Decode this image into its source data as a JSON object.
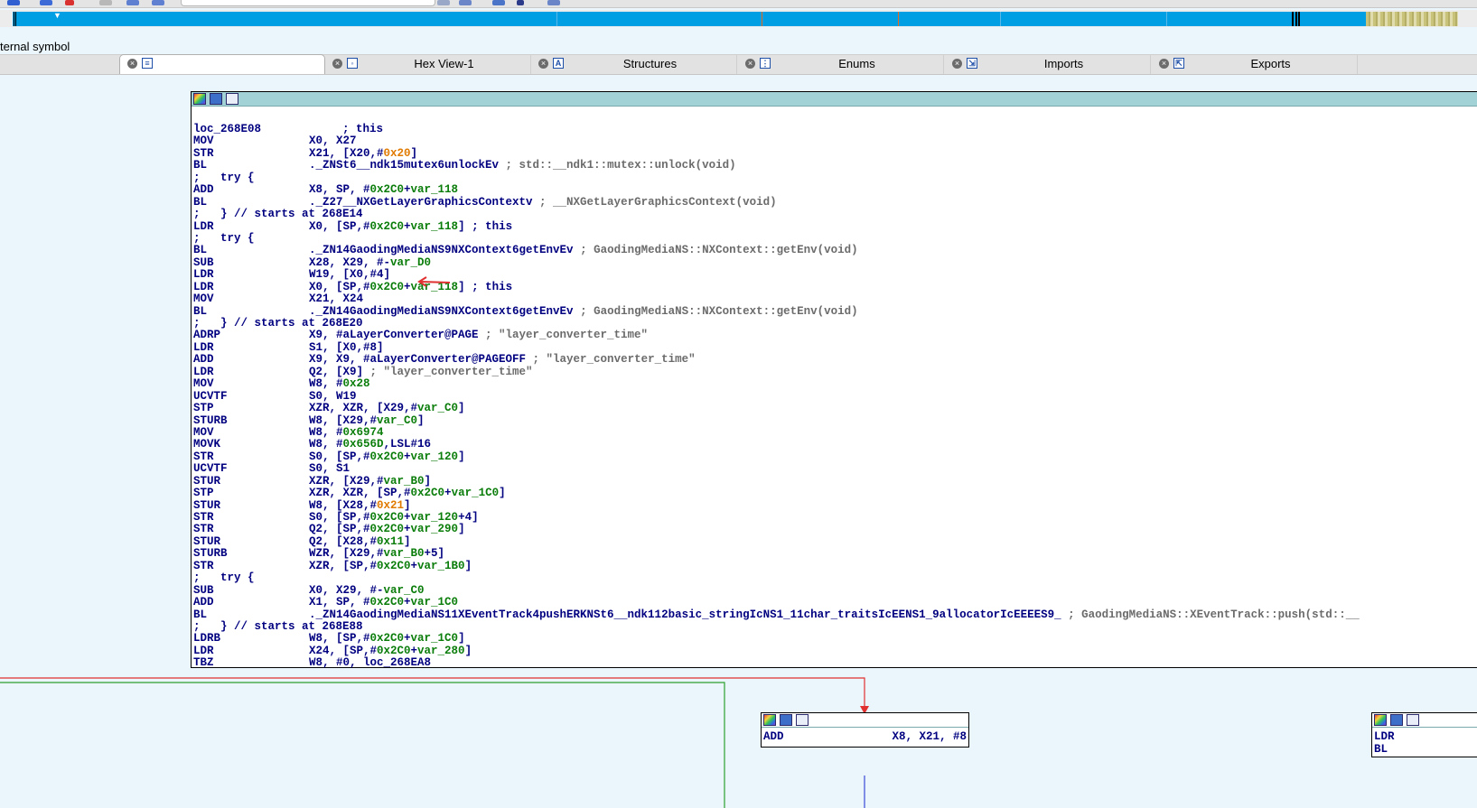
{
  "colors": {
    "nav_blue": "#009fe3",
    "nav_orange_marks": "#e66b1e",
    "node_header": "#a3d2d6",
    "edge_red": "#e03030",
    "edge_green": "#2ea02e",
    "edge_blue": "#3a4ad8",
    "instruction": "#000080",
    "number": "#0b7d0b",
    "immediate": "#e07a00",
    "comment": "#6b6b6b"
  },
  "status": {
    "text": "ternal symbol"
  },
  "tabs": [
    {
      "label": "",
      "icon": "disassembly-icon",
      "active": true
    },
    {
      "label": "Hex View-1",
      "icon": "hex-view-icon",
      "active": false
    },
    {
      "label": "Structures",
      "icon": "structures-icon",
      "active": false
    },
    {
      "label": "Enums",
      "icon": "enums-icon",
      "active": false
    },
    {
      "label": "Imports",
      "icon": "imports-icon",
      "active": false
    },
    {
      "label": "Exports",
      "icon": "exports-icon",
      "active": false
    }
  ],
  "main_node": {
    "lines": [
      [
        {
          "t": "loc_268E08",
          "c": "ops"
        },
        {
          "t": "            ; this",
          "c": "ops"
        }
      ],
      [
        {
          "t": "MOV",
          "c": "mn"
        },
        {
          "t": "X0, X27",
          "c": "ops"
        }
      ],
      [
        {
          "t": "STR",
          "c": "mn"
        },
        {
          "t": "X21, [X20,#",
          "c": "ops"
        },
        {
          "t": "0x20",
          "c": "imm"
        },
        {
          "t": "]",
          "c": "ops"
        }
      ],
      [
        {
          "t": "BL",
          "c": "mn"
        },
        {
          "t": "._ZNSt6__ndk15mutex6unlockEv",
          "c": "ops"
        },
        {
          "t": " ; std::__ndk1::mutex::unlock(void)",
          "c": "cmt"
        }
      ],
      [
        {
          "t": ";   try {",
          "c": "ops"
        }
      ],
      [
        {
          "t": "ADD",
          "c": "mn"
        },
        {
          "t": "X8, SP, #",
          "c": "ops"
        },
        {
          "t": "0x2C0",
          "c": "num"
        },
        {
          "t": "+",
          "c": "ops"
        },
        {
          "t": "var_118",
          "c": "num"
        }
      ],
      [
        {
          "t": "BL",
          "c": "mn"
        },
        {
          "t": "._Z27__NXGetLayerGraphicsContextv",
          "c": "ops"
        },
        {
          "t": " ; __NXGetLayerGraphicsContext(void)",
          "c": "cmt"
        }
      ],
      [
        {
          "t": ";   } // starts at 268E14",
          "c": "ops"
        }
      ],
      [
        {
          "t": "LDR",
          "c": "mn"
        },
        {
          "t": "X0, [SP,#",
          "c": "ops"
        },
        {
          "t": "0x2C0",
          "c": "num"
        },
        {
          "t": "+",
          "c": "ops"
        },
        {
          "t": "var_118",
          "c": "num"
        },
        {
          "t": "] ; this",
          "c": "ops"
        }
      ],
      [
        {
          "t": ";   try {",
          "c": "ops"
        }
      ],
      [
        {
          "t": "BL",
          "c": "mn"
        },
        {
          "t": "._ZN14GaodingMediaNS9NXContext6getEnvEv",
          "c": "ops"
        },
        {
          "t": " ; GaodingMediaNS::NXContext::getEnv(void)",
          "c": "cmt"
        }
      ],
      [
        {
          "t": "SUB",
          "c": "mn"
        },
        {
          "t": "X28, X29, #-",
          "c": "ops"
        },
        {
          "t": "var_D0",
          "c": "num"
        }
      ],
      [
        {
          "t": "LDR",
          "c": "mn"
        },
        {
          "t": "W19, [X0,#4]",
          "c": "ops"
        }
      ],
      [
        {
          "t": "LDR",
          "c": "mn"
        },
        {
          "t": "X0, [SP,#",
          "c": "ops"
        },
        {
          "t": "0x2C0",
          "c": "num"
        },
        {
          "t": "+",
          "c": "ops"
        },
        {
          "t": "var_118",
          "c": "num"
        },
        {
          "t": "] ; this",
          "c": "ops"
        }
      ],
      [
        {
          "t": "MOV",
          "c": "mn"
        },
        {
          "t": "X21, X24",
          "c": "ops"
        }
      ],
      [
        {
          "t": "BL",
          "c": "mn"
        },
        {
          "t": "._ZN14GaodingMediaNS9NXContext6getEnvEv",
          "c": "ops"
        },
        {
          "t": " ; GaodingMediaNS::NXContext::getEnv(void)",
          "c": "cmt"
        }
      ],
      [
        {
          "t": ";   } // starts at 268E20",
          "c": "ops"
        }
      ],
      [
        {
          "t": "ADRP",
          "c": "mn"
        },
        {
          "t": "X9, #aLayerConverter@PAGE",
          "c": "ops"
        },
        {
          "t": " ; \"layer_converter_time\"",
          "c": "cmt"
        }
      ],
      [
        {
          "t": "LDR",
          "c": "mn"
        },
        {
          "t": "S1, [X0,#8]",
          "c": "ops"
        }
      ],
      [
        {
          "t": "ADD",
          "c": "mn"
        },
        {
          "t": "X9, X9, #aLayerConverter@PAGEOFF",
          "c": "ops"
        },
        {
          "t": " ; \"layer_converter_time\"",
          "c": "cmt"
        }
      ],
      [
        {
          "t": "LDR",
          "c": "mn"
        },
        {
          "t": "Q2, [X9]",
          "c": "ops"
        },
        {
          "t": " ; \"layer_converter_time\"",
          "c": "cmt"
        }
      ],
      [
        {
          "t": "MOV",
          "c": "mn"
        },
        {
          "t": "W8, #",
          "c": "ops"
        },
        {
          "t": "0x28",
          "c": "num"
        }
      ],
      [
        {
          "t": "UCVTF",
          "c": "mn"
        },
        {
          "t": "S0, W19",
          "c": "ops"
        }
      ],
      [
        {
          "t": "STP",
          "c": "mn"
        },
        {
          "t": "XZR, XZR, [X29,#",
          "c": "ops"
        },
        {
          "t": "var_C0",
          "c": "num"
        },
        {
          "t": "]",
          "c": "ops"
        }
      ],
      [
        {
          "t": "STURB",
          "c": "mn"
        },
        {
          "t": "W8, [X29,#",
          "c": "ops"
        },
        {
          "t": "var_C0",
          "c": "num"
        },
        {
          "t": "]",
          "c": "ops"
        }
      ],
      [
        {
          "t": "MOV",
          "c": "mn"
        },
        {
          "t": "W8, #",
          "c": "ops"
        },
        {
          "t": "0x6974",
          "c": "num"
        }
      ],
      [
        {
          "t": "MOVK",
          "c": "mn"
        },
        {
          "t": "W8, #",
          "c": "ops"
        },
        {
          "t": "0x656D",
          "c": "num"
        },
        {
          "t": ",LSL#16",
          "c": "ops"
        }
      ],
      [
        {
          "t": "STR",
          "c": "mn"
        },
        {
          "t": "S0, [SP,#",
          "c": "ops"
        },
        {
          "t": "0x2C0",
          "c": "num"
        },
        {
          "t": "+",
          "c": "ops"
        },
        {
          "t": "var_120",
          "c": "num"
        },
        {
          "t": "]",
          "c": "ops"
        }
      ],
      [
        {
          "t": "UCVTF",
          "c": "mn"
        },
        {
          "t": "S0, S1",
          "c": "ops"
        }
      ],
      [
        {
          "t": "STUR",
          "c": "mn"
        },
        {
          "t": "XZR, [X29,#",
          "c": "ops"
        },
        {
          "t": "var_B0",
          "c": "num"
        },
        {
          "t": "]",
          "c": "ops"
        }
      ],
      [
        {
          "t": "STP",
          "c": "mn"
        },
        {
          "t": "XZR, XZR, [SP,#",
          "c": "ops"
        },
        {
          "t": "0x2C0",
          "c": "num"
        },
        {
          "t": "+",
          "c": "ops"
        },
        {
          "t": "var_1C0",
          "c": "num"
        },
        {
          "t": "]",
          "c": "ops"
        }
      ],
      [
        {
          "t": "STUR",
          "c": "mn"
        },
        {
          "t": "W8, [X28,#",
          "c": "ops"
        },
        {
          "t": "0x21",
          "c": "imm"
        },
        {
          "t": "]",
          "c": "ops"
        }
      ],
      [
        {
          "t": "STR",
          "c": "mn"
        },
        {
          "t": "S0, [SP,#",
          "c": "ops"
        },
        {
          "t": "0x2C0",
          "c": "num"
        },
        {
          "t": "+",
          "c": "ops"
        },
        {
          "t": "var_120",
          "c": "num"
        },
        {
          "t": "+4]",
          "c": "ops"
        }
      ],
      [
        {
          "t": "STR",
          "c": "mn"
        },
        {
          "t": "Q2, [SP,#",
          "c": "ops"
        },
        {
          "t": "0x2C0",
          "c": "num"
        },
        {
          "t": "+",
          "c": "ops"
        },
        {
          "t": "var_290",
          "c": "num"
        },
        {
          "t": "]",
          "c": "ops"
        }
      ],
      [
        {
          "t": "STUR",
          "c": "mn"
        },
        {
          "t": "Q2, [X28,#",
          "c": "ops"
        },
        {
          "t": "0x11",
          "c": "num"
        },
        {
          "t": "]",
          "c": "ops"
        }
      ],
      [
        {
          "t": "STURB",
          "c": "mn"
        },
        {
          "t": "WZR, [X29,#",
          "c": "ops"
        },
        {
          "t": "var_B0",
          "c": "num"
        },
        {
          "t": "+5]",
          "c": "ops"
        }
      ],
      [
        {
          "t": "STR",
          "c": "mn"
        },
        {
          "t": "XZR, [SP,#",
          "c": "ops"
        },
        {
          "t": "0x2C0",
          "c": "num"
        },
        {
          "t": "+",
          "c": "ops"
        },
        {
          "t": "var_1B0",
          "c": "num"
        },
        {
          "t": "]",
          "c": "ops"
        }
      ],
      [
        {
          "t": ";   try {",
          "c": "ops"
        }
      ],
      [
        {
          "t": "SUB",
          "c": "mn"
        },
        {
          "t": "X0, X29, #-",
          "c": "ops"
        },
        {
          "t": "var_C0",
          "c": "num"
        }
      ],
      [
        {
          "t": "ADD",
          "c": "mn"
        },
        {
          "t": "X1, SP, #",
          "c": "ops"
        },
        {
          "t": "0x2C0",
          "c": "num"
        },
        {
          "t": "+",
          "c": "ops"
        },
        {
          "t": "var_1C0",
          "c": "num"
        }
      ],
      [
        {
          "t": "BL",
          "c": "mn"
        },
        {
          "t": "._ZN14GaodingMediaNS11XEventTrack4pushERKNSt6__ndk112basic_stringIcNS1_11char_traitsIcEENS1_9allocatorIcEEEES9_",
          "c": "ops"
        },
        {
          "t": " ; GaodingMediaNS::XEventTrack::push(std::__",
          "c": "cmt"
        }
      ],
      [
        {
          "t": ";   } // starts at 268E88",
          "c": "ops"
        }
      ],
      [
        {
          "t": "LDRB",
          "c": "mn"
        },
        {
          "t": "W8, [SP,#",
          "c": "ops"
        },
        {
          "t": "0x2C0",
          "c": "num"
        },
        {
          "t": "+",
          "c": "ops"
        },
        {
          "t": "var_1C0",
          "c": "num"
        },
        {
          "t": "]",
          "c": "ops"
        }
      ],
      [
        {
          "t": "LDR",
          "c": "mn"
        },
        {
          "t": "X24, [SP,#",
          "c": "ops"
        },
        {
          "t": "0x2C0",
          "c": "num"
        },
        {
          "t": "+",
          "c": "ops"
        },
        {
          "t": "var_280",
          "c": "num"
        },
        {
          "t": "]",
          "c": "ops"
        }
      ],
      [
        {
          "t": "TBZ",
          "c": "mn"
        },
        {
          "t": "W8, #0, loc_268EA8",
          "c": "ops"
        }
      ]
    ]
  },
  "node_add": {
    "mnemonic": "ADD",
    "operands": "X8, X21, #8"
  },
  "node_right": {
    "line1": "LDR",
    "line2": "BL"
  }
}
